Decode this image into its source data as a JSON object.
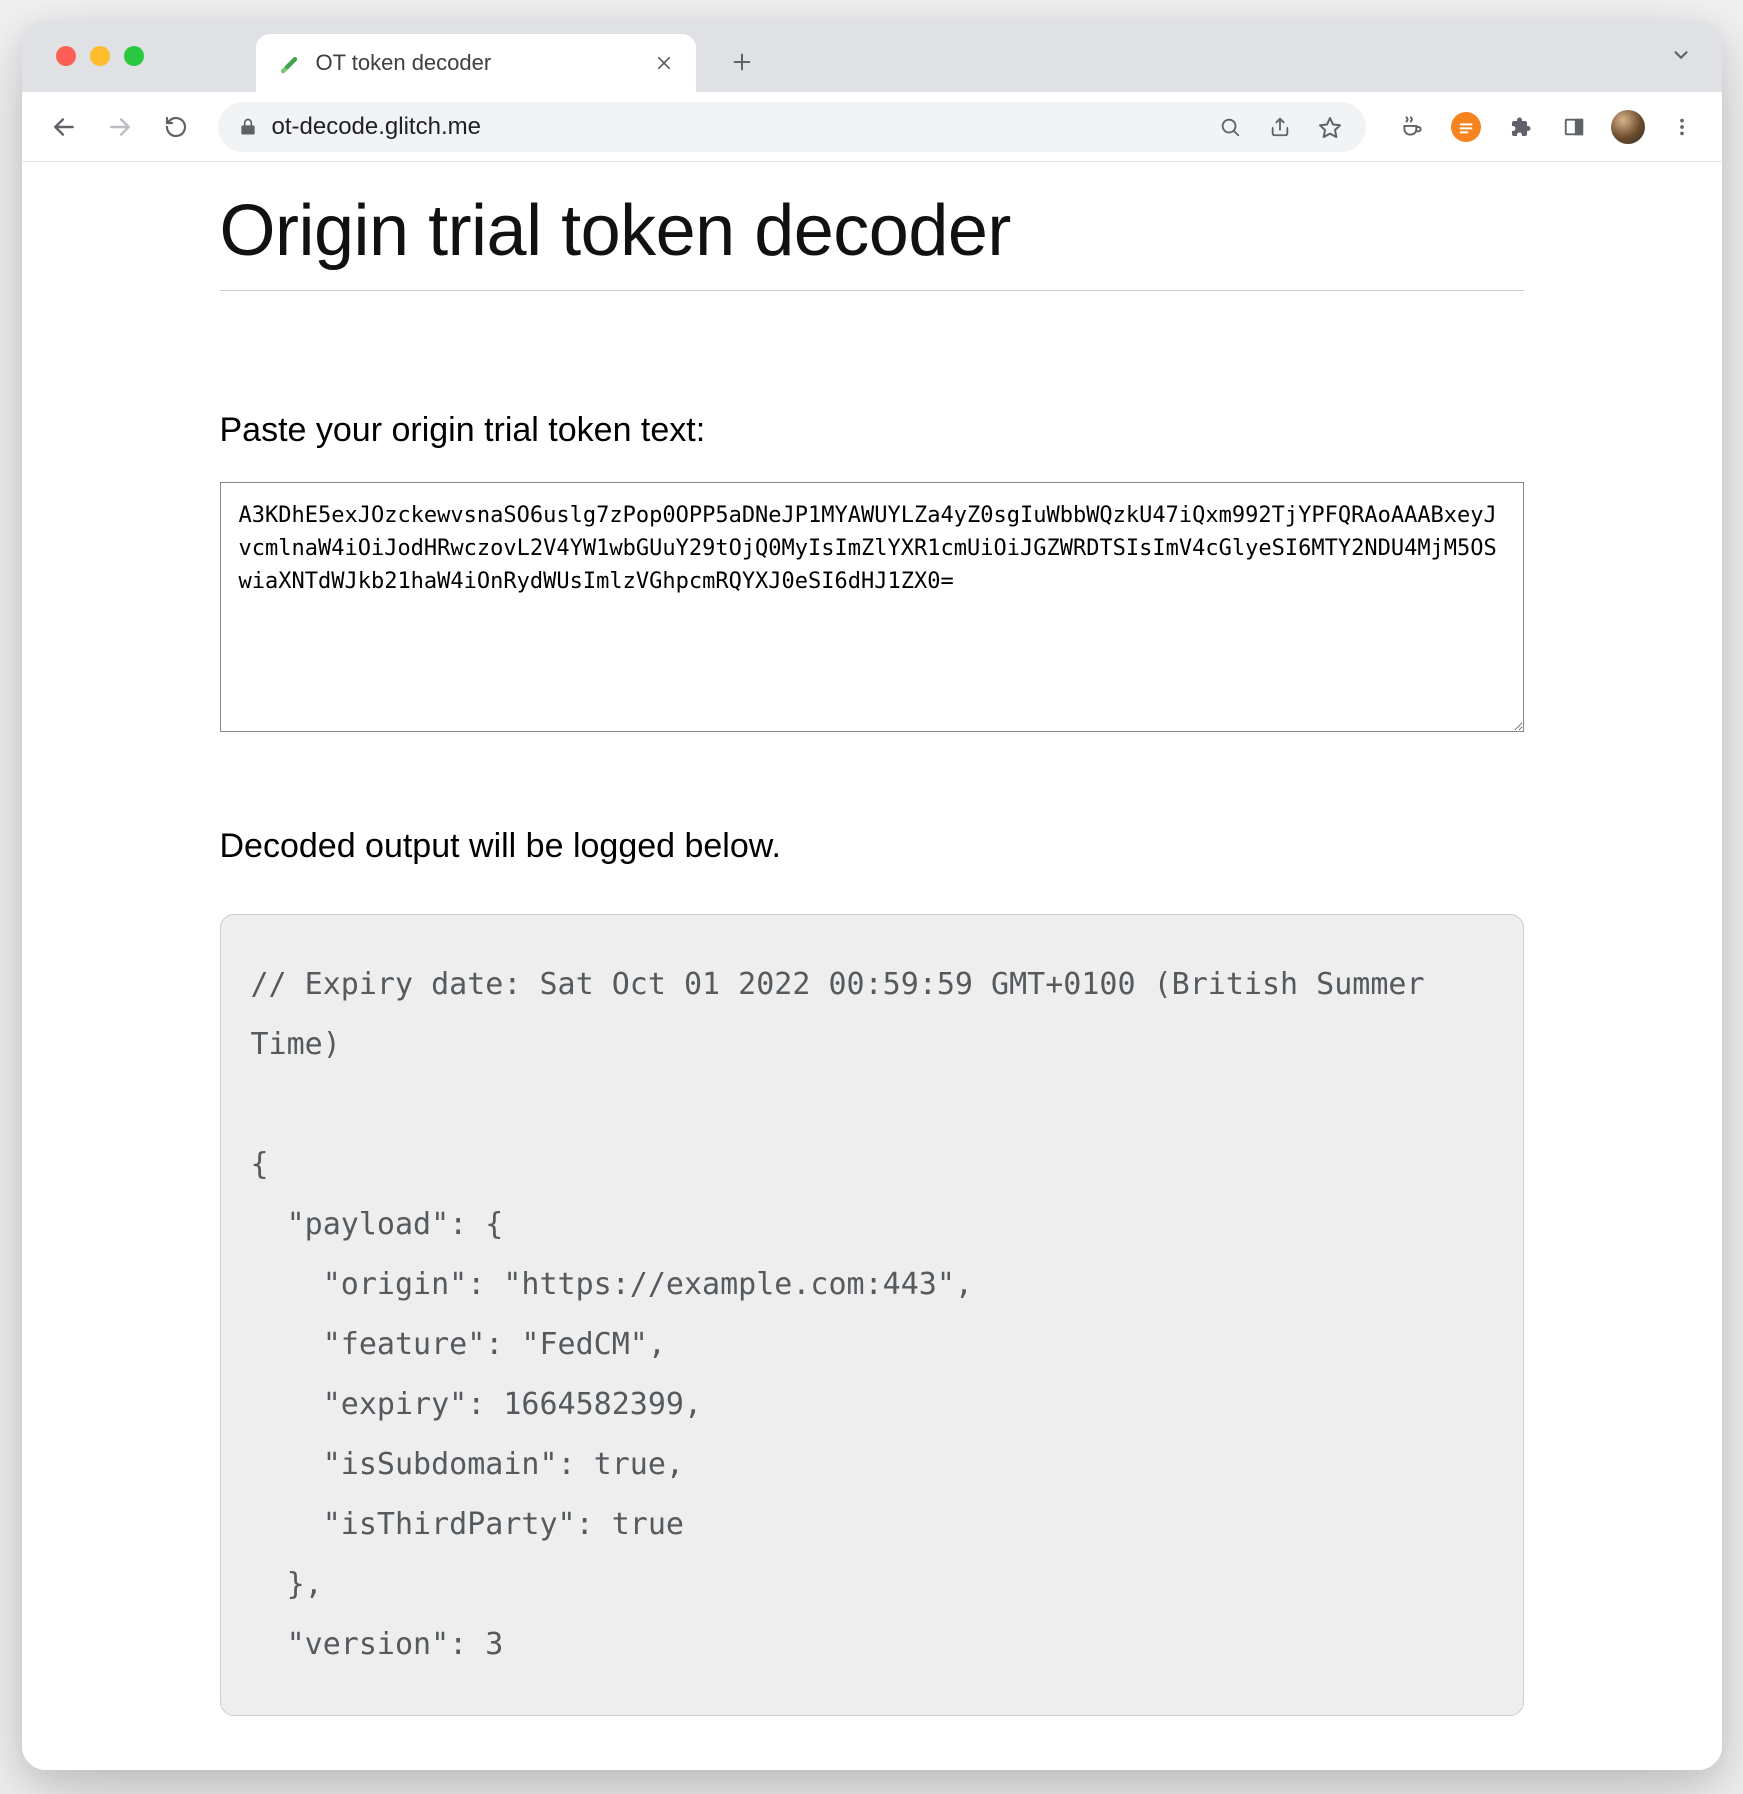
{
  "browser": {
    "tab_title": "OT token decoder",
    "url": "ot-decode.glitch.me"
  },
  "page": {
    "title": "Origin trial token decoder",
    "input_label": "Paste your origin trial token text:",
    "token_value": "A3KDhE5exJOzckewvsnaSO6uslg7zPop0OPP5aDNeJP1MYAWUYLZa4yZ0sgIuWbbWQzkU47iQxm992TjYPFQRAoAAABxeyJvcmlnaW4iOiJodHRwczovL2V4YW1wbGUuY29tOjQ0MyIsImZlYXR1cmUiOiJGZWRDTSIsImV4cGlyeSI6MTY2NDU4MjM5OSwiaXNTdWJkb21haW4iOnRydWUsImlzVGhpcmRQYXJ0eSI6dHJ1ZX0=",
    "output_label": "Decoded output will be logged below.",
    "output_text": "// Expiry date: Sat Oct 01 2022 00:59:59 GMT+0100 (British Summer Time)\n\n{\n  \"payload\": {\n    \"origin\": \"https://example.com:443\",\n    \"feature\": \"FedCM\",\n    \"expiry\": 1664582399,\n    \"isSubdomain\": true,\n    \"isThirdParty\": true\n  },\n  \"version\": 3"
  },
  "decoded": {
    "expiry_human": "Sat Oct 01 2022 00:59:59 GMT+0100 (British Summer Time)",
    "payload": {
      "origin": "https://example.com:443",
      "feature": "FedCM",
      "expiry": 1664582399,
      "isSubdomain": true,
      "isThirdParty": true
    },
    "version": 3
  }
}
